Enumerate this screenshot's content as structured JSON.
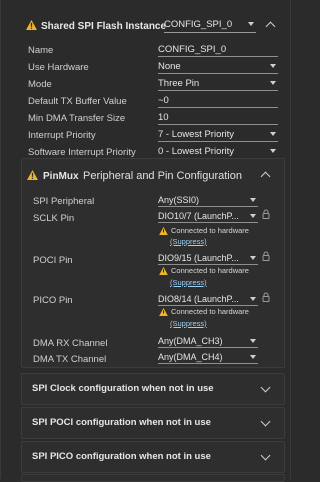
{
  "header": {
    "title": "Shared SPI Flash Instance",
    "instance_value": "CONFIG_SPI_0"
  },
  "fields": [
    {
      "label": "Name",
      "value": "CONFIG_SPI_0"
    },
    {
      "label": "Use Hardware",
      "value": "None"
    },
    {
      "label": "Mode",
      "value": "Three Pin"
    },
    {
      "label": "Default TX Buffer Value",
      "value": "~0"
    },
    {
      "label": "Min DMA Transfer Size",
      "value": "10"
    },
    {
      "label": "Interrupt Priority",
      "value": "7 - Lowest Priority"
    },
    {
      "label": "Software Interrupt Priority",
      "value": "0 - Lowest Priority"
    }
  ],
  "pinmux": {
    "title": "PinMux",
    "subtitle": "Peripheral and Pin Configuration",
    "spi_peripheral": {
      "label": "SPI Peripheral",
      "value": "Any(SSI0)"
    },
    "sclk": {
      "label": "SCLK Pin",
      "value": "DIO10/7 (LaunchP..."
    },
    "poci": {
      "label": "POCI Pin",
      "value": "DIO9/15 (LaunchP..."
    },
    "pico": {
      "label": "PICO Pin",
      "value": "DIO8/14 (LaunchP..."
    },
    "connected_note": "Connected to hardware",
    "suppress_label": "(Suppress)",
    "dma_rx": {
      "label": "DMA RX Channel",
      "value": "Any(DMA_CH3)"
    },
    "dma_tx": {
      "label": "DMA TX Channel",
      "value": "Any(DMA_CH4)"
    }
  },
  "sections": [
    "SPI Clock configuration when not in use",
    "SPI POCI configuration when not in use",
    "SPI PICO configuration when not in use"
  ],
  "colors": {
    "warning": "#f0b429",
    "link": "#9ad0f5",
    "background": "#2b2b2b"
  }
}
